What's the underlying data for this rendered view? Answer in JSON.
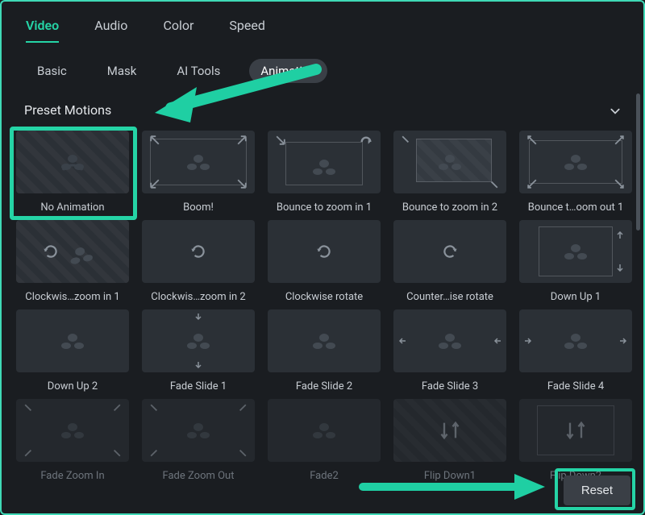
{
  "top_tabs": {
    "video": "Video",
    "audio": "Audio",
    "color": "Color",
    "speed": "Speed"
  },
  "sub_tabs": {
    "basic": "Basic",
    "mask": "Mask",
    "ai_tools": "AI Tools",
    "animation": "Animation"
  },
  "section": {
    "title": "Preset Motions"
  },
  "presets": [
    {
      "label": "No Animation"
    },
    {
      "label": "Boom!"
    },
    {
      "label": "Bounce to zoom in 1"
    },
    {
      "label": "Bounce to zoom in 2"
    },
    {
      "label": "Bounce t…oom out 1"
    },
    {
      "label": "Clockwis…zoom in 1"
    },
    {
      "label": "Clockwis…zoom in 2"
    },
    {
      "label": "Clockwise rotate"
    },
    {
      "label": "Counter…ise rotate"
    },
    {
      "label": "Down Up 1"
    },
    {
      "label": "Down Up 2"
    },
    {
      "label": "Fade Slide 1"
    },
    {
      "label": "Fade Slide 2"
    },
    {
      "label": "Fade Slide 3"
    },
    {
      "label": "Fade Slide 4"
    },
    {
      "label": "Fade Zoom In"
    },
    {
      "label": "Fade Zoom Out"
    },
    {
      "label": "Fade2"
    },
    {
      "label": "Flip Down1"
    },
    {
      "label": "Flip Down2"
    }
  ],
  "footer": {
    "reset_label": "Reset"
  },
  "colors": {
    "accent": "#25d4a6"
  }
}
